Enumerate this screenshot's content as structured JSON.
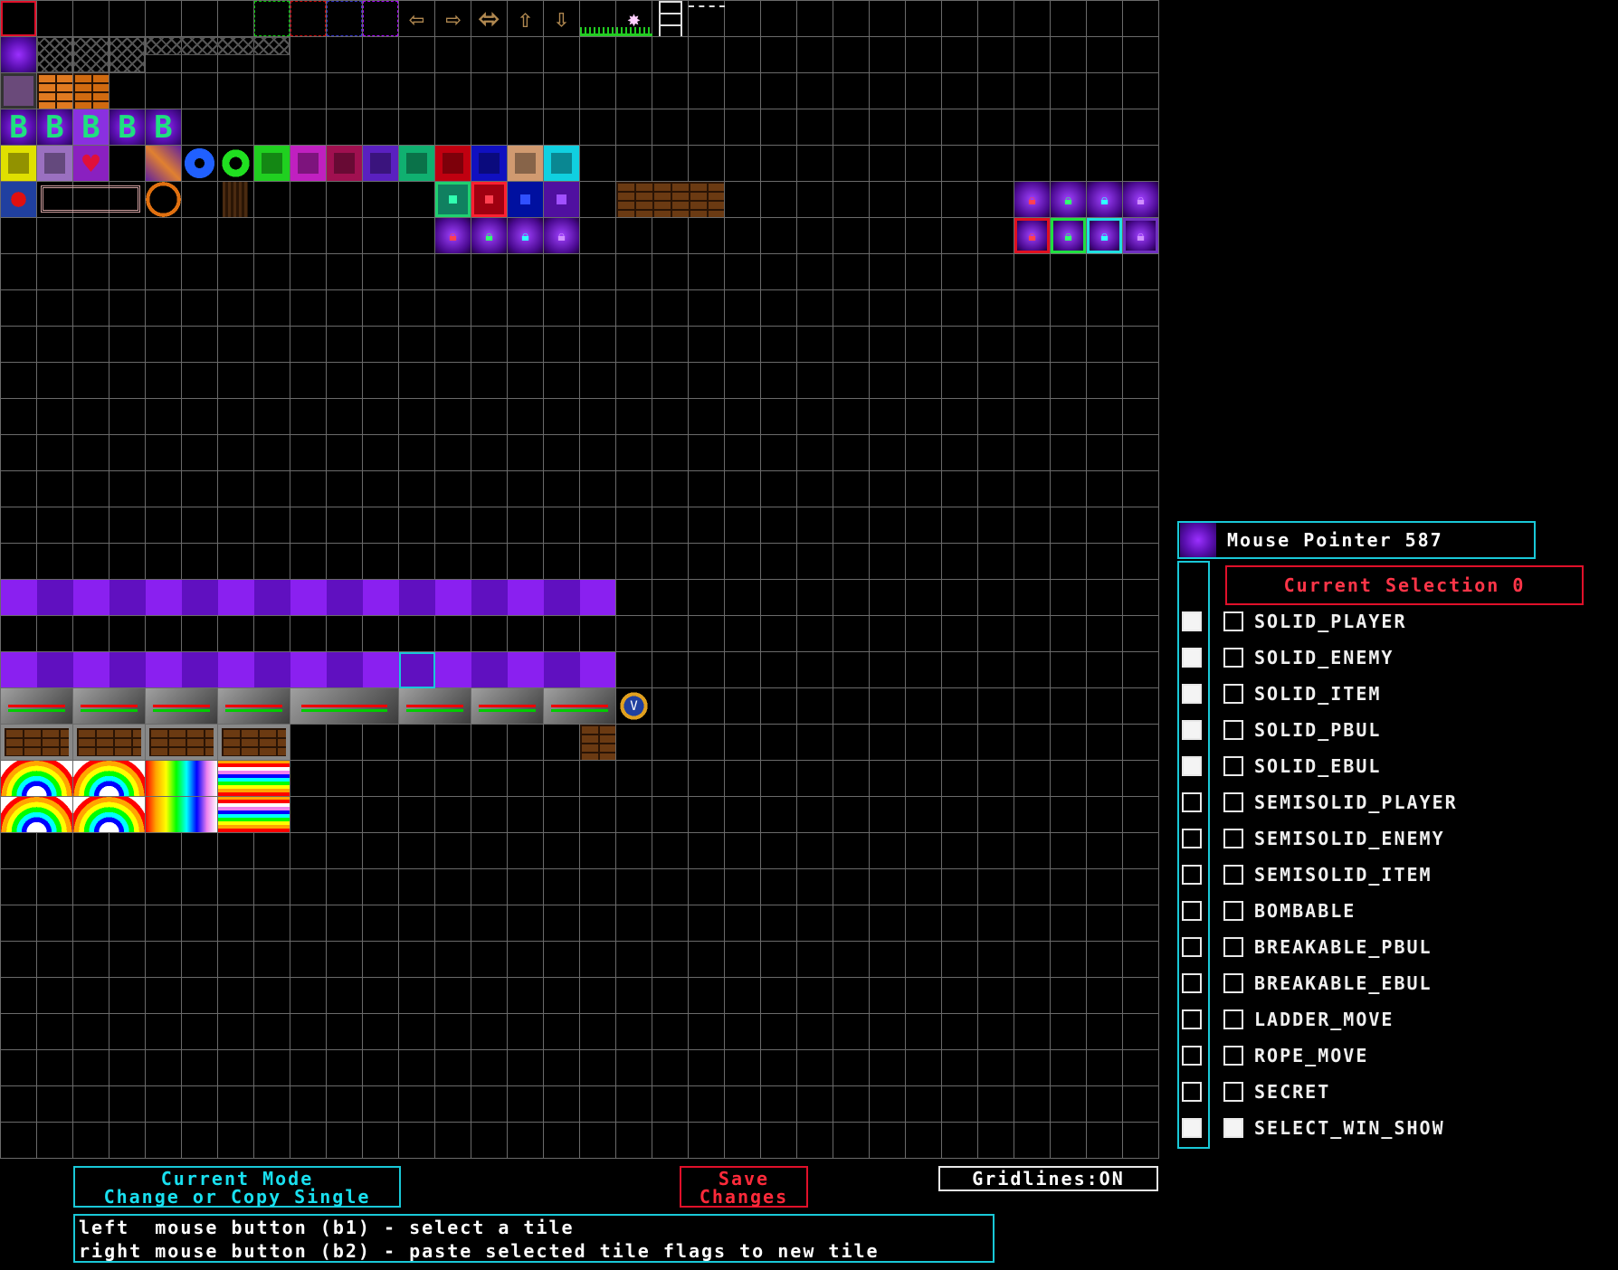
{
  "mouse_pointer": {
    "label": "Mouse Pointer 587"
  },
  "current_selection": {
    "label": "Current Selection 0"
  },
  "flags": [
    {
      "name": "SOLID_PLAYER",
      "left_checked": true,
      "right_checked": false
    },
    {
      "name": "SOLID_ENEMY",
      "left_checked": true,
      "right_checked": false
    },
    {
      "name": "SOLID_ITEM",
      "left_checked": true,
      "right_checked": false
    },
    {
      "name": "SOLID_PBUL",
      "left_checked": true,
      "right_checked": false
    },
    {
      "name": "SOLID_EBUL",
      "left_checked": true,
      "right_checked": false
    },
    {
      "name": "SEMISOLID_PLAYER",
      "left_checked": false,
      "right_checked": false
    },
    {
      "name": "SEMISOLID_ENEMY",
      "left_checked": false,
      "right_checked": false
    },
    {
      "name": "SEMISOLID_ITEM",
      "left_checked": false,
      "right_checked": false
    },
    {
      "name": "BOMBABLE",
      "left_checked": false,
      "right_checked": false
    },
    {
      "name": "BREAKABLE_PBUL",
      "left_checked": false,
      "right_checked": false
    },
    {
      "name": "BREAKABLE_EBUL",
      "left_checked": false,
      "right_checked": false
    },
    {
      "name": "LADDER_MOVE",
      "left_checked": false,
      "right_checked": false
    },
    {
      "name": "ROPE_MOVE",
      "left_checked": false,
      "right_checked": false
    },
    {
      "name": "SECRET",
      "left_checked": false,
      "right_checked": false
    },
    {
      "name": "SELECT_WIN_SHOW",
      "left_checked": true,
      "right_checked": true
    }
  ],
  "mode": {
    "line1": "Current Mode",
    "line2": "Change or Copy Single"
  },
  "save": {
    "line1": "Save",
    "line2": "Changes"
  },
  "gridlines": {
    "label": "Gridlines:ON"
  },
  "help": {
    "line1": "left  mouse button (b1) - select a tile",
    "line2": "right mouse button (b2) - paste selected tile flags to new tile"
  },
  "tile_icons": {
    "arrows": [
      "left-arrow-icon",
      "right-arrow-icon",
      "left-right-arrow-icon",
      "up-arrow-icon",
      "down-arrow-icon"
    ],
    "letters": [
      "B",
      "B",
      "B",
      "B",
      "B"
    ]
  },
  "colors": {
    "accent_cyan": "#19c8d8",
    "accent_red": "#e0102a",
    "grid_line": "#6a6a6a",
    "tile_purple": "#9b30ff"
  }
}
